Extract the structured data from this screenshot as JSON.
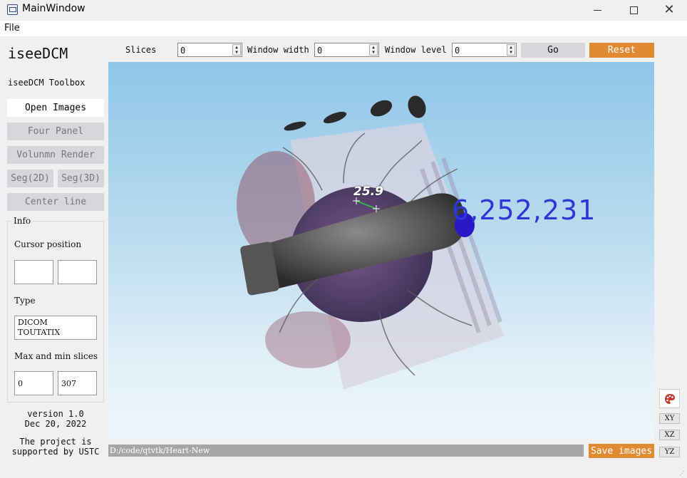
{
  "window": {
    "title": "MainWindow",
    "minimize": "—",
    "maximize": "☐",
    "close": "✕"
  },
  "menu": {
    "file": "File"
  },
  "sidebar": {
    "app_title": "iseeDCM",
    "toolbox_label": "iseeDCM Toolbox",
    "buttons": {
      "open_images": "Open Images",
      "four_panel": "Four Panel",
      "volume_render": "Volunmn Render",
      "seg2d": "Seg(2D)",
      "seg3d": "Seg(3D)",
      "center_line": "Center line"
    },
    "info": {
      "title": "Info",
      "cursor_position_label": "Cursor position",
      "cursor_x": "",
      "cursor_y": "",
      "type_label": "Type",
      "type_value": "DICOM\nTOUTATIX",
      "slices_label": "Max and min slices",
      "min_slice": "0",
      "max_slice": "307"
    },
    "version": "version 1.0\nDec 20, 2022",
    "support": "The project is\nsupported by USTC"
  },
  "controls": {
    "slices_label": "Slices",
    "slices_value": "0",
    "window_width_label": "Window width",
    "window_width_value": "0",
    "window_level_label": "Window level",
    "window_level_value": "0",
    "go_label": "Go",
    "reset_label": "Reset"
  },
  "viewport": {
    "coordinate_readout": "6,252,231",
    "measurement": "25.9"
  },
  "footer": {
    "path": "D:/code/qtvtk/Heart-New",
    "save_label": "Save images"
  },
  "right_panel": {
    "palette_icon": "palette-icon",
    "xy": "XY",
    "xz": "XZ",
    "yz": "YZ"
  },
  "colors": {
    "accent": "#e08a32",
    "disabled_button": "#d6d7db",
    "readout_blue": "#2d36d6"
  }
}
